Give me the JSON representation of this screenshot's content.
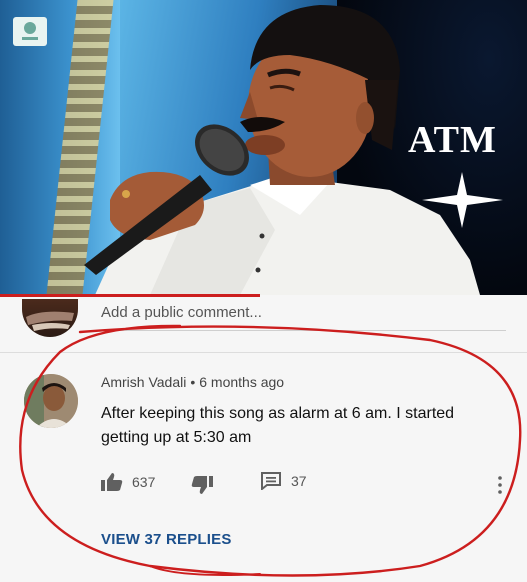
{
  "image": {
    "overlay_text": "ATM"
  },
  "comment_box": {
    "placeholder": "Add a public comment..."
  },
  "comment": {
    "author": "Amrish Vadali",
    "separator": "•",
    "time": "6 months ago",
    "text": "After keeping this song as alarm at 6 am. I started getting up at 5:30 am",
    "likes": "637",
    "reply_count": "37",
    "view_replies_label": "VIEW 37 REPLIES"
  },
  "colors": {
    "link_blue": "#1b4f8c",
    "annotation_red": "#cc1e1e"
  },
  "icons": [
    "thumbs-up-icon",
    "thumbs-down-icon",
    "reply-icon",
    "more-vert-icon",
    "sparkle-star-icon",
    "channel-logo-icon"
  ]
}
